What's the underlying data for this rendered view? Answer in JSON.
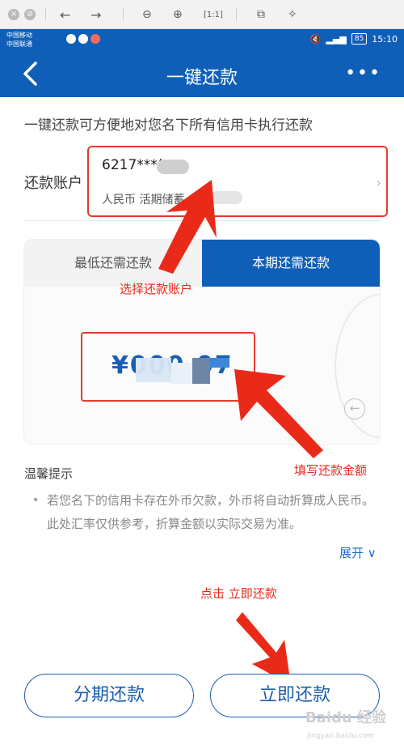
{
  "browser": {
    "icons": [
      "close-icon",
      "stop-icon",
      "back-icon",
      "forward-icon",
      "zoom-out-icon",
      "zoom-in-icon",
      "fit-icon",
      "rotate-icon",
      "magic-wand-icon"
    ]
  },
  "status": {
    "carrier1": "中国移动",
    "carrier2": "中国联通",
    "battery": "85",
    "time": "15:10"
  },
  "header": {
    "title": "一键还款",
    "more": "•••"
  },
  "description": "一键还款可方便地对您名下所有信用卡执行还款",
  "account": {
    "label": "还款账户",
    "number": "6217***(",
    "type": "人民币 活期储蓄"
  },
  "tabs": {
    "left": "最低还需还款",
    "right": "本期还需还款"
  },
  "amount": {
    "value": "¥000.07"
  },
  "tips": {
    "title": "温馨提示",
    "bullet": "•",
    "text": "若您名下的信用卡存在外币欠款，外币将自动折算成人民币。此处汇率仅供参考，折算金额以实际交易为准。",
    "expand": "展开 ∨"
  },
  "annotations": {
    "select_account": "选择还款账户",
    "fill_amount": "填写还款金额",
    "click_pay": "点击 立即还款"
  },
  "buttons": {
    "installment": "分期还款",
    "pay_now": "立即还款"
  },
  "watermark": {
    "main": "Baidu 经验",
    "sub": "jingyan.baidu.com"
  },
  "colors": {
    "brand_blue": "#0f5fb8",
    "annotation_red": "#e32b1c",
    "link_blue": "#1a6fd0"
  }
}
